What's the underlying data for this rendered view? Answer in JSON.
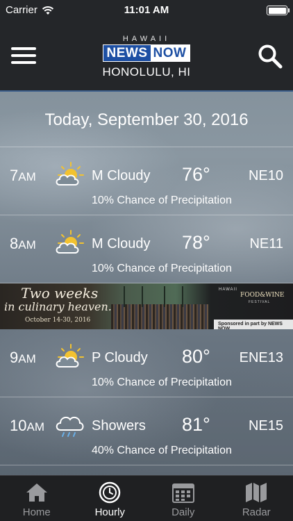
{
  "status_bar": {
    "carrier": "Carrier",
    "time": "11:01 AM"
  },
  "header": {
    "logo_top": "HAWAII",
    "logo_news": "NEWS",
    "logo_now": "NOW",
    "location": "HONOLULU, HI"
  },
  "date": "Today, September 30, 2016",
  "hours": [
    {
      "hour": "7",
      "ampm": "AM",
      "icon": "partly-cloudy-sun-icon",
      "condition": "M Cloudy",
      "temp": "76°",
      "wind": "NE10",
      "precip": "10% Chance of Precipitation"
    },
    {
      "hour": "8",
      "ampm": "AM",
      "icon": "partly-cloudy-sun-icon",
      "condition": "M Cloudy",
      "temp": "78°",
      "wind": "NE11",
      "precip": "10% Chance of Precipitation"
    },
    {
      "hour": "9",
      "ampm": "AM",
      "icon": "partly-cloudy-sun-icon",
      "condition": "P Cloudy",
      "temp": "80°",
      "wind": "ENE13",
      "precip": "10% Chance of Precipitation"
    },
    {
      "hour": "10",
      "ampm": "AM",
      "icon": "showers-cloud-icon",
      "condition": "Showers",
      "temp": "81°",
      "wind": "NE15",
      "precip": "40% Chance of Precipitation"
    }
  ],
  "ad": {
    "line1": "Two weeks",
    "line2": "in culinary heaven.",
    "dates": "October 14-30, 2016",
    "brand_top": "HAWAII",
    "brand_name": "FOOD&WINE",
    "brand_sub": "FESTIVAL",
    "sponsor": "Sponsored in part by NEWS NOW"
  },
  "tabs": [
    {
      "label": "Home",
      "icon": "home-icon",
      "active": false
    },
    {
      "label": "Hourly",
      "icon": "clock-icon",
      "active": true
    },
    {
      "label": "Daily",
      "icon": "calendar-icon",
      "active": false
    },
    {
      "label": "Radar",
      "icon": "map-icon",
      "active": false
    }
  ],
  "colors": {
    "header_bg": "#242629",
    "header_border": "#3d5f8c",
    "logo_blue": "#1d4fa3",
    "tab_inactive": "#9a9b9e"
  }
}
